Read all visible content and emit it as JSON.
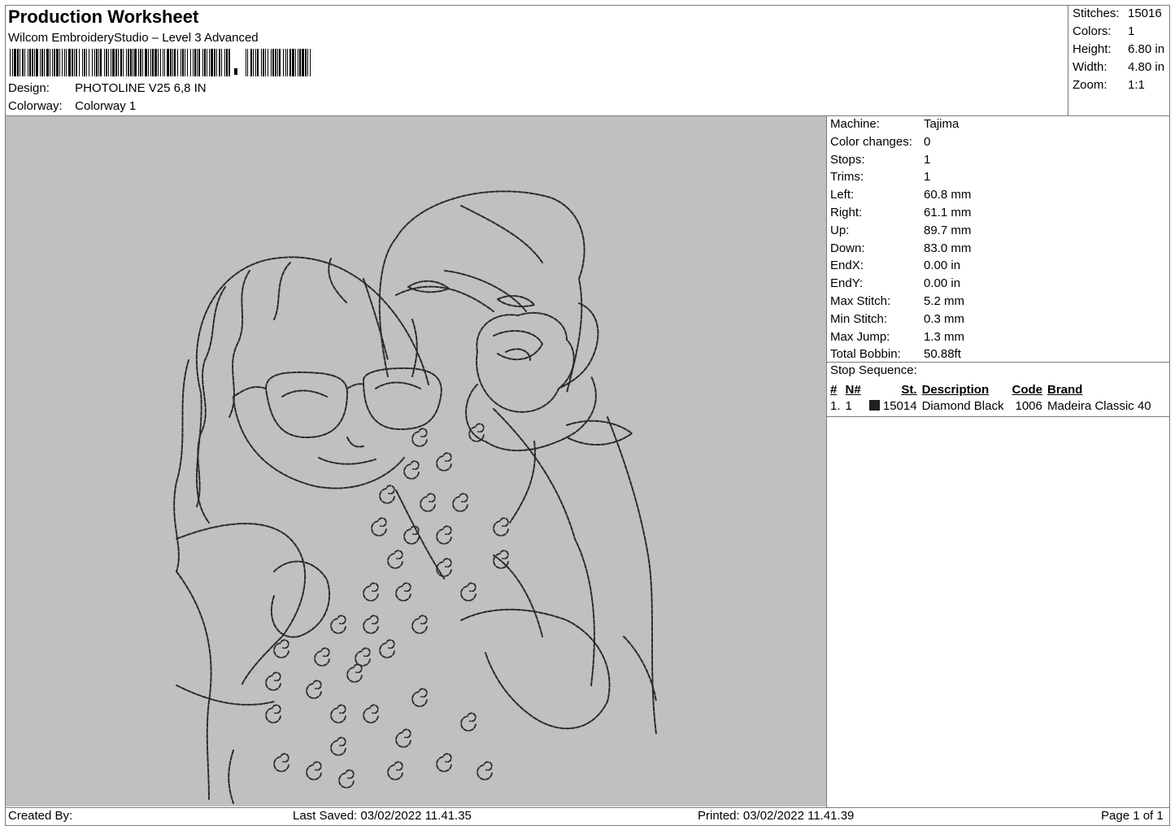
{
  "header": {
    "title": "Production Worksheet",
    "software": "Wilcom EmbroideryStudio – Level 3 Advanced",
    "design_label": "Design:",
    "design_value": "PHOTOLINE V25 6,8 IN",
    "colorway_label": "Colorway:",
    "colorway_value": "Colorway 1"
  },
  "summary": [
    {
      "label": "Stitches:",
      "value": "15016"
    },
    {
      "label": "Colors:",
      "value": "1"
    },
    {
      "label": "Height:",
      "value": "6.80 in"
    },
    {
      "label": "Width:",
      "value": "4.80 in"
    },
    {
      "label": "Zoom:",
      "value": "1:1"
    }
  ],
  "machine_info": [
    {
      "label": "Machine:",
      "value": "Tajima"
    },
    {
      "label": "Color changes:",
      "value": "0"
    },
    {
      "label": "Stops:",
      "value": "1"
    },
    {
      "label": "Trims:",
      "value": "1"
    },
    {
      "label": "Left:",
      "value": "60.8 mm"
    },
    {
      "label": "Right:",
      "value": "61.1 mm"
    },
    {
      "label": "Up:",
      "value": "89.7 mm"
    },
    {
      "label": "Down:",
      "value": "83.0 mm"
    },
    {
      "label": "EndX:",
      "value": "0.00 in"
    },
    {
      "label": "EndY:",
      "value": "0.00 in"
    },
    {
      "label": "Max Stitch:",
      "value": "5.2 mm"
    },
    {
      "label": "Min Stitch:",
      "value": "0.3 mm"
    },
    {
      "label": "Max Jump:",
      "value": "1.3 mm"
    },
    {
      "label": "Total Bobbin:",
      "value": "50.88ft"
    }
  ],
  "stop_sequence": {
    "label": "Stop Sequence:",
    "headers": {
      "num": "#",
      "needle": "N#",
      "st": "St.",
      "description": "Description",
      "code": "Code",
      "brand": "Brand"
    },
    "rows": [
      {
        "num": "1.",
        "needle": "1",
        "color": "#1f1f1f",
        "st": "15014",
        "description": "Diamond Black",
        "code": "1006",
        "brand": "Madeira Classic 40"
      }
    ]
  },
  "footer": {
    "created_by": "Created By:",
    "last_saved": "Last Saved: 03/02/2022 11.41.35",
    "printed": "Printed: 03/02/2022 11.41.39",
    "page": "Page 1 of 1"
  },
  "colors": {
    "preview_background": "#c0c0c0",
    "stitch": "#2a2a2a"
  }
}
